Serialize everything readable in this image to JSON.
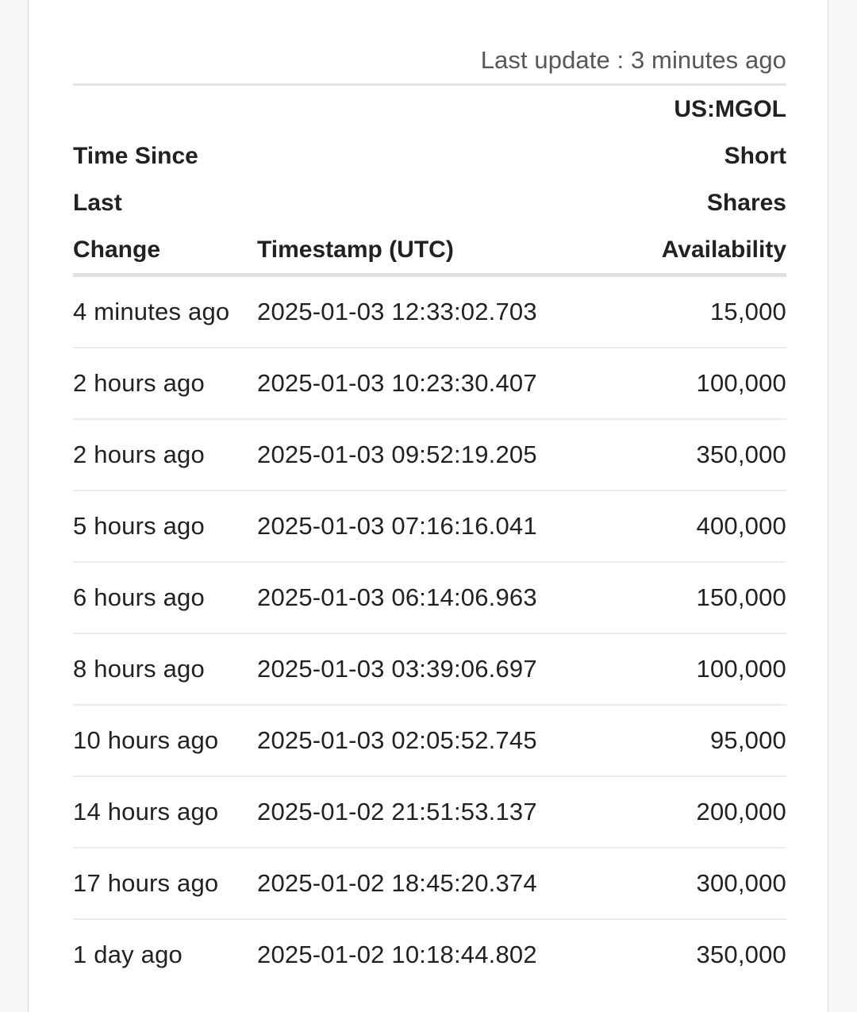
{
  "meta": {
    "last_update_label": "Last update : 3 minutes ago"
  },
  "table": {
    "headers": {
      "time_since_last_change": "Time Since Last Change",
      "time_since_last_change_lines": [
        "Time Since",
        "Last",
        "Change"
      ],
      "timestamp": "Timestamp (UTC)",
      "availability": "US:MGOL Short Shares Availability",
      "availability_lines": [
        "US:MGOL Short",
        "Shares",
        "Availability"
      ]
    },
    "rows": [
      {
        "time_since": "4 minutes ago",
        "timestamp": "2025-01-03 12:33:02.703",
        "availability": "15,000"
      },
      {
        "time_since": "2 hours ago",
        "timestamp": "2025-01-03 10:23:30.407",
        "availability": "100,000"
      },
      {
        "time_since": "2 hours ago",
        "timestamp": "2025-01-03 09:52:19.205",
        "availability": "350,000"
      },
      {
        "time_since": "5 hours ago",
        "timestamp": "2025-01-03 07:16:16.041",
        "availability": "400,000"
      },
      {
        "time_since": "6 hours ago",
        "timestamp": "2025-01-03 06:14:06.963",
        "availability": "150,000"
      },
      {
        "time_since": "8 hours ago",
        "timestamp": "2025-01-03 03:39:06.697",
        "availability": "100,000"
      },
      {
        "time_since": "10 hours ago",
        "timestamp": "2025-01-03 02:05:52.745",
        "availability": "95,000"
      },
      {
        "time_since": "14 hours ago",
        "timestamp": "2025-01-02 21:51:53.137",
        "availability": "200,000"
      },
      {
        "time_since": "17 hours ago",
        "timestamp": "2025-01-02 18:45:20.374",
        "availability": "300,000"
      },
      {
        "time_since": "1 day ago",
        "timestamp": "2025-01-02 10:18:44.802",
        "availability": "350,000"
      }
    ]
  },
  "colors": {
    "page_background": "#f7f7f7",
    "pane_background": "#ffffff",
    "pane_border": "#d4d6d8",
    "text_primary": "#1f2124",
    "text_muted": "#555759",
    "rule_header": "#dfe1e3",
    "rule_row": "#ececee"
  }
}
